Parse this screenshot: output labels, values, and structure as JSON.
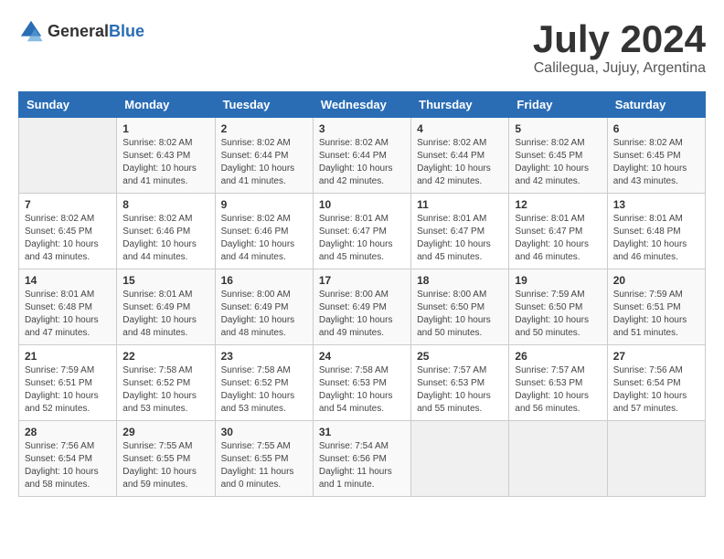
{
  "header": {
    "logo_general": "General",
    "logo_blue": "Blue",
    "month_year": "July 2024",
    "location": "Calilegua, Jujuy, Argentina"
  },
  "calendar": {
    "days_of_week": [
      "Sunday",
      "Monday",
      "Tuesday",
      "Wednesday",
      "Thursday",
      "Friday",
      "Saturday"
    ],
    "weeks": [
      [
        {
          "day": "",
          "info": ""
        },
        {
          "day": "1",
          "info": "Sunrise: 8:02 AM\nSunset: 6:43 PM\nDaylight: 10 hours\nand 41 minutes."
        },
        {
          "day": "2",
          "info": "Sunrise: 8:02 AM\nSunset: 6:44 PM\nDaylight: 10 hours\nand 41 minutes."
        },
        {
          "day": "3",
          "info": "Sunrise: 8:02 AM\nSunset: 6:44 PM\nDaylight: 10 hours\nand 42 minutes."
        },
        {
          "day": "4",
          "info": "Sunrise: 8:02 AM\nSunset: 6:44 PM\nDaylight: 10 hours\nand 42 minutes."
        },
        {
          "day": "5",
          "info": "Sunrise: 8:02 AM\nSunset: 6:45 PM\nDaylight: 10 hours\nand 42 minutes."
        },
        {
          "day": "6",
          "info": "Sunrise: 8:02 AM\nSunset: 6:45 PM\nDaylight: 10 hours\nand 43 minutes."
        }
      ],
      [
        {
          "day": "7",
          "info": "Sunrise: 8:02 AM\nSunset: 6:45 PM\nDaylight: 10 hours\nand 43 minutes."
        },
        {
          "day": "8",
          "info": "Sunrise: 8:02 AM\nSunset: 6:46 PM\nDaylight: 10 hours\nand 44 minutes."
        },
        {
          "day": "9",
          "info": "Sunrise: 8:02 AM\nSunset: 6:46 PM\nDaylight: 10 hours\nand 44 minutes."
        },
        {
          "day": "10",
          "info": "Sunrise: 8:01 AM\nSunset: 6:47 PM\nDaylight: 10 hours\nand 45 minutes."
        },
        {
          "day": "11",
          "info": "Sunrise: 8:01 AM\nSunset: 6:47 PM\nDaylight: 10 hours\nand 45 minutes."
        },
        {
          "day": "12",
          "info": "Sunrise: 8:01 AM\nSunset: 6:47 PM\nDaylight: 10 hours\nand 46 minutes."
        },
        {
          "day": "13",
          "info": "Sunrise: 8:01 AM\nSunset: 6:48 PM\nDaylight: 10 hours\nand 46 minutes."
        }
      ],
      [
        {
          "day": "14",
          "info": "Sunrise: 8:01 AM\nSunset: 6:48 PM\nDaylight: 10 hours\nand 47 minutes."
        },
        {
          "day": "15",
          "info": "Sunrise: 8:01 AM\nSunset: 6:49 PM\nDaylight: 10 hours\nand 48 minutes."
        },
        {
          "day": "16",
          "info": "Sunrise: 8:00 AM\nSunset: 6:49 PM\nDaylight: 10 hours\nand 48 minutes."
        },
        {
          "day": "17",
          "info": "Sunrise: 8:00 AM\nSunset: 6:49 PM\nDaylight: 10 hours\nand 49 minutes."
        },
        {
          "day": "18",
          "info": "Sunrise: 8:00 AM\nSunset: 6:50 PM\nDaylight: 10 hours\nand 50 minutes."
        },
        {
          "day": "19",
          "info": "Sunrise: 7:59 AM\nSunset: 6:50 PM\nDaylight: 10 hours\nand 50 minutes."
        },
        {
          "day": "20",
          "info": "Sunrise: 7:59 AM\nSunset: 6:51 PM\nDaylight: 10 hours\nand 51 minutes."
        }
      ],
      [
        {
          "day": "21",
          "info": "Sunrise: 7:59 AM\nSunset: 6:51 PM\nDaylight: 10 hours\nand 52 minutes."
        },
        {
          "day": "22",
          "info": "Sunrise: 7:58 AM\nSunset: 6:52 PM\nDaylight: 10 hours\nand 53 minutes."
        },
        {
          "day": "23",
          "info": "Sunrise: 7:58 AM\nSunset: 6:52 PM\nDaylight: 10 hours\nand 53 minutes."
        },
        {
          "day": "24",
          "info": "Sunrise: 7:58 AM\nSunset: 6:53 PM\nDaylight: 10 hours\nand 54 minutes."
        },
        {
          "day": "25",
          "info": "Sunrise: 7:57 AM\nSunset: 6:53 PM\nDaylight: 10 hours\nand 55 minutes."
        },
        {
          "day": "26",
          "info": "Sunrise: 7:57 AM\nSunset: 6:53 PM\nDaylight: 10 hours\nand 56 minutes."
        },
        {
          "day": "27",
          "info": "Sunrise: 7:56 AM\nSunset: 6:54 PM\nDaylight: 10 hours\nand 57 minutes."
        }
      ],
      [
        {
          "day": "28",
          "info": "Sunrise: 7:56 AM\nSunset: 6:54 PM\nDaylight: 10 hours\nand 58 minutes."
        },
        {
          "day": "29",
          "info": "Sunrise: 7:55 AM\nSunset: 6:55 PM\nDaylight: 10 hours\nand 59 minutes."
        },
        {
          "day": "30",
          "info": "Sunrise: 7:55 AM\nSunset: 6:55 PM\nDaylight: 11 hours\nand 0 minutes."
        },
        {
          "day": "31",
          "info": "Sunrise: 7:54 AM\nSunset: 6:56 PM\nDaylight: 11 hours\nand 1 minute."
        },
        {
          "day": "",
          "info": ""
        },
        {
          "day": "",
          "info": ""
        },
        {
          "day": "",
          "info": ""
        }
      ]
    ]
  }
}
